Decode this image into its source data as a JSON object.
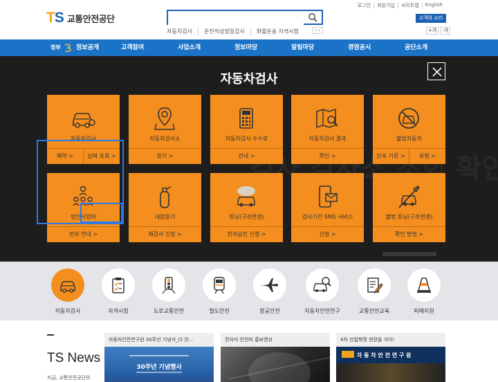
{
  "brand": {
    "ts_t": "T",
    "ts_s": "S",
    "name": "교통안전공단"
  },
  "search": {
    "value": "",
    "placeholder": "",
    "keywords": [
      "자동차검사",
      "운전적성정밀검사",
      "화물운송 자격시험"
    ],
    "nav": "‹ ›"
  },
  "util": {
    "links": [
      "로그인",
      "회원가입",
      "사이트맵",
      "English"
    ],
    "voice": "고객의 소리",
    "font_plus": "+가",
    "font_minus": "-가"
  },
  "gnb": {
    "gov_label": "정부",
    "items": [
      "정보공개",
      "고객참여",
      "사업소개",
      "정보마당",
      "알림마당",
      "경영공시",
      "공단소개"
    ]
  },
  "panel": {
    "title": "자동차검사",
    "bg_text": "검사 검사소 조회 확인",
    "tiles": [
      {
        "label": "자동차검사",
        "links": [
          "예약 >",
          "날짜 조회 >"
        ]
      },
      {
        "label": "자동차검사소",
        "links": [
          "찾기 >"
        ]
      },
      {
        "label": "자동차검사 수수료",
        "links": [
          "안내 >"
        ]
      },
      {
        "label": "자동차검사 결과",
        "links": [
          "확인 >"
        ]
      },
      {
        "label": "불법자동차",
        "links": [
          "단속 기준 >",
          "유형 >"
        ]
      },
      {
        "label": "법인사업자",
        "links": [
          "전자 안내 >"
        ]
      },
      {
        "label": "내압용기",
        "links": [
          "재검사 신청 >"
        ]
      },
      {
        "label": "튜닝(구조변경)",
        "links": [
          "전자승인 신청 >"
        ]
      },
      {
        "label": "검사기간 SMS 서비스",
        "links": [
          "신청 >"
        ]
      },
      {
        "label": "불법 튜닝(구조변경)",
        "links": [
          "확인 방법 >"
        ]
      }
    ]
  },
  "categories": [
    {
      "label": "자동차검사",
      "icon": "car-check-icon"
    },
    {
      "label": "자격시험",
      "icon": "clipboard-icon"
    },
    {
      "label": "도로교통안전",
      "icon": "traffic-light-icon"
    },
    {
      "label": "철도안전",
      "icon": "train-icon"
    },
    {
      "label": "항공안전",
      "icon": "airplane-icon"
    },
    {
      "label": "자동차안전연구",
      "icon": "car-research-icon"
    },
    {
      "label": "교통안전교육",
      "icon": "document-edit-icon"
    },
    {
      "label": "피해지원",
      "icon": "cone-icon"
    }
  ],
  "news": {
    "title": "TS News",
    "desc": "지금, 교통안전공단의",
    "cards": [
      {
        "caption": "자동차안전연구원 30주년 기념식_더 안...",
        "img_text": "30주년 기념행사"
      },
      {
        "caption": "전자식 안전띠 홍보영상",
        "img_text": ""
      },
      {
        "caption": "4차 산업혁명 현장을 가다!",
        "img_text": "자 동 차 안 전 연 구 원"
      }
    ]
  },
  "colors": {
    "blue": "#1b73c8",
    "orange": "#f48e1e",
    "dark": "#1d1d1d",
    "gray": "#e3e5e9"
  }
}
